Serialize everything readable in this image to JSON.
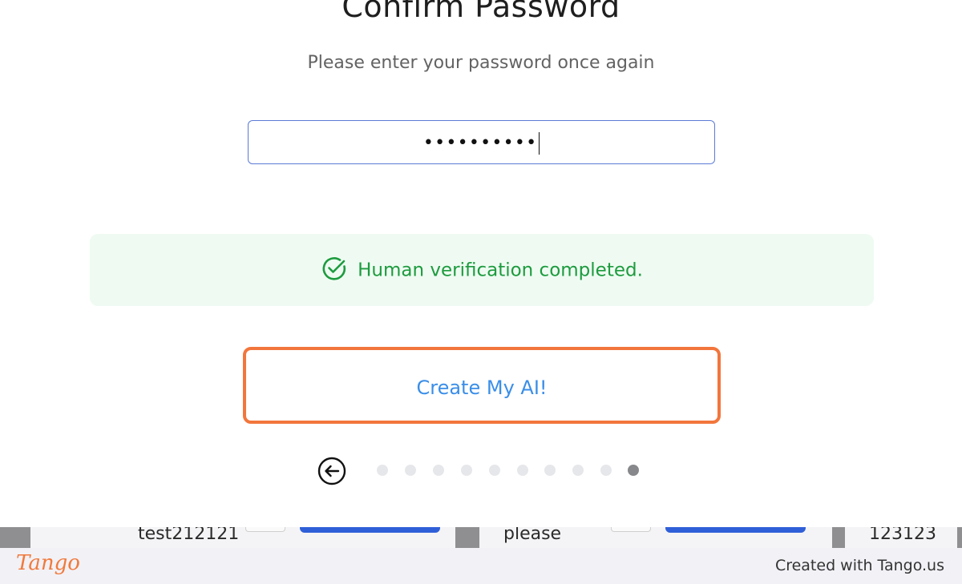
{
  "modal": {
    "title": "Confirm Password",
    "subtitle": "Please enter your password once again",
    "password": {
      "masked_value": "••••••••••"
    },
    "verification": {
      "message": "Human verification completed.",
      "color": "#1d9b3f",
      "icon": "check-circle-icon"
    },
    "create_button": {
      "label": "Create My AI!",
      "highlight_color": "#f2763c"
    },
    "stepper": {
      "back_icon": "arrow-left-circle-icon",
      "total_steps": 10,
      "current_step": 10
    }
  },
  "background_page": {
    "cells": [
      "test212121",
      "please",
      "123123"
    ]
  },
  "footer": {
    "logo": "Tango",
    "credit": "Created with Tango.us"
  }
}
